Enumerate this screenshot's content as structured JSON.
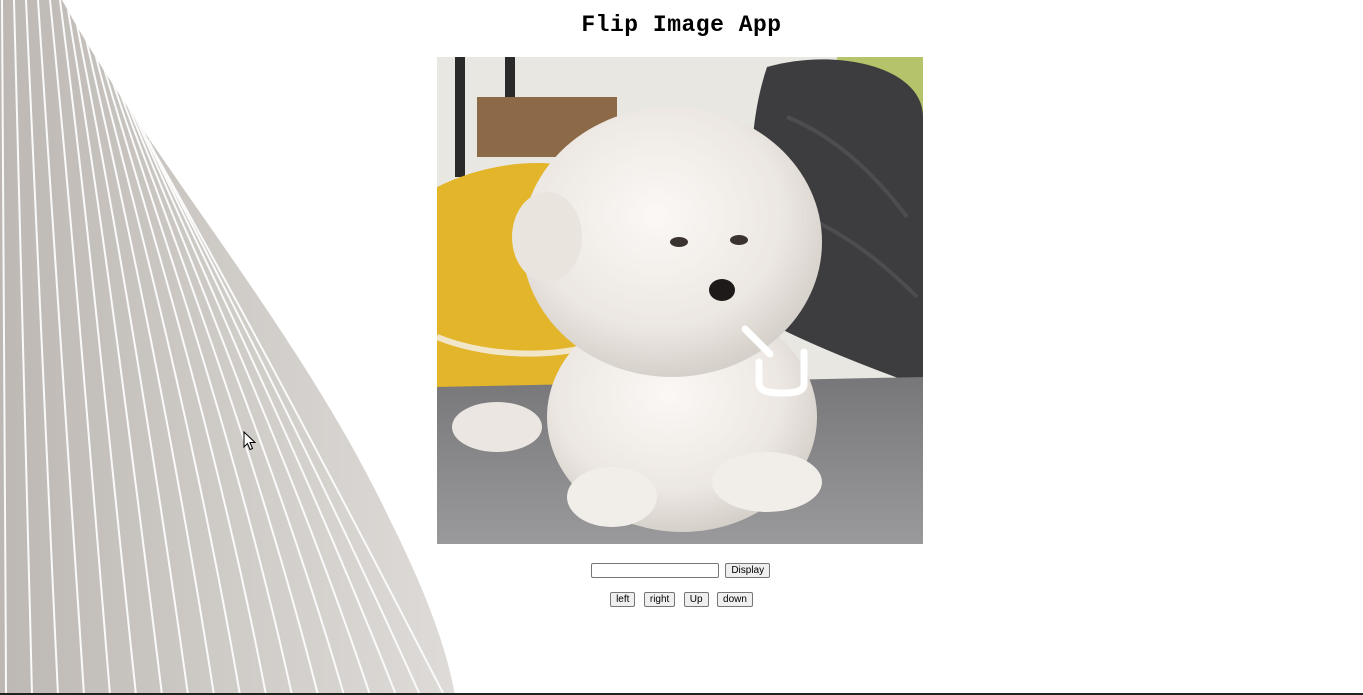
{
  "app": {
    "title": "Flip Image App"
  },
  "image": {
    "alt": "fluffy white puppy photo"
  },
  "controls": {
    "input_value": "",
    "input_placeholder": "",
    "display_label": "Display",
    "left_label": "left",
    "right_label": "right",
    "up_label": "Up",
    "down_label": "down"
  },
  "icons": {
    "cursor": "mouse-pointer-icon"
  },
  "colors": {
    "background": "#ffffff",
    "button_bg": "#efefef",
    "button_border": "#767676",
    "decor_gray": "#c9c5c1"
  }
}
